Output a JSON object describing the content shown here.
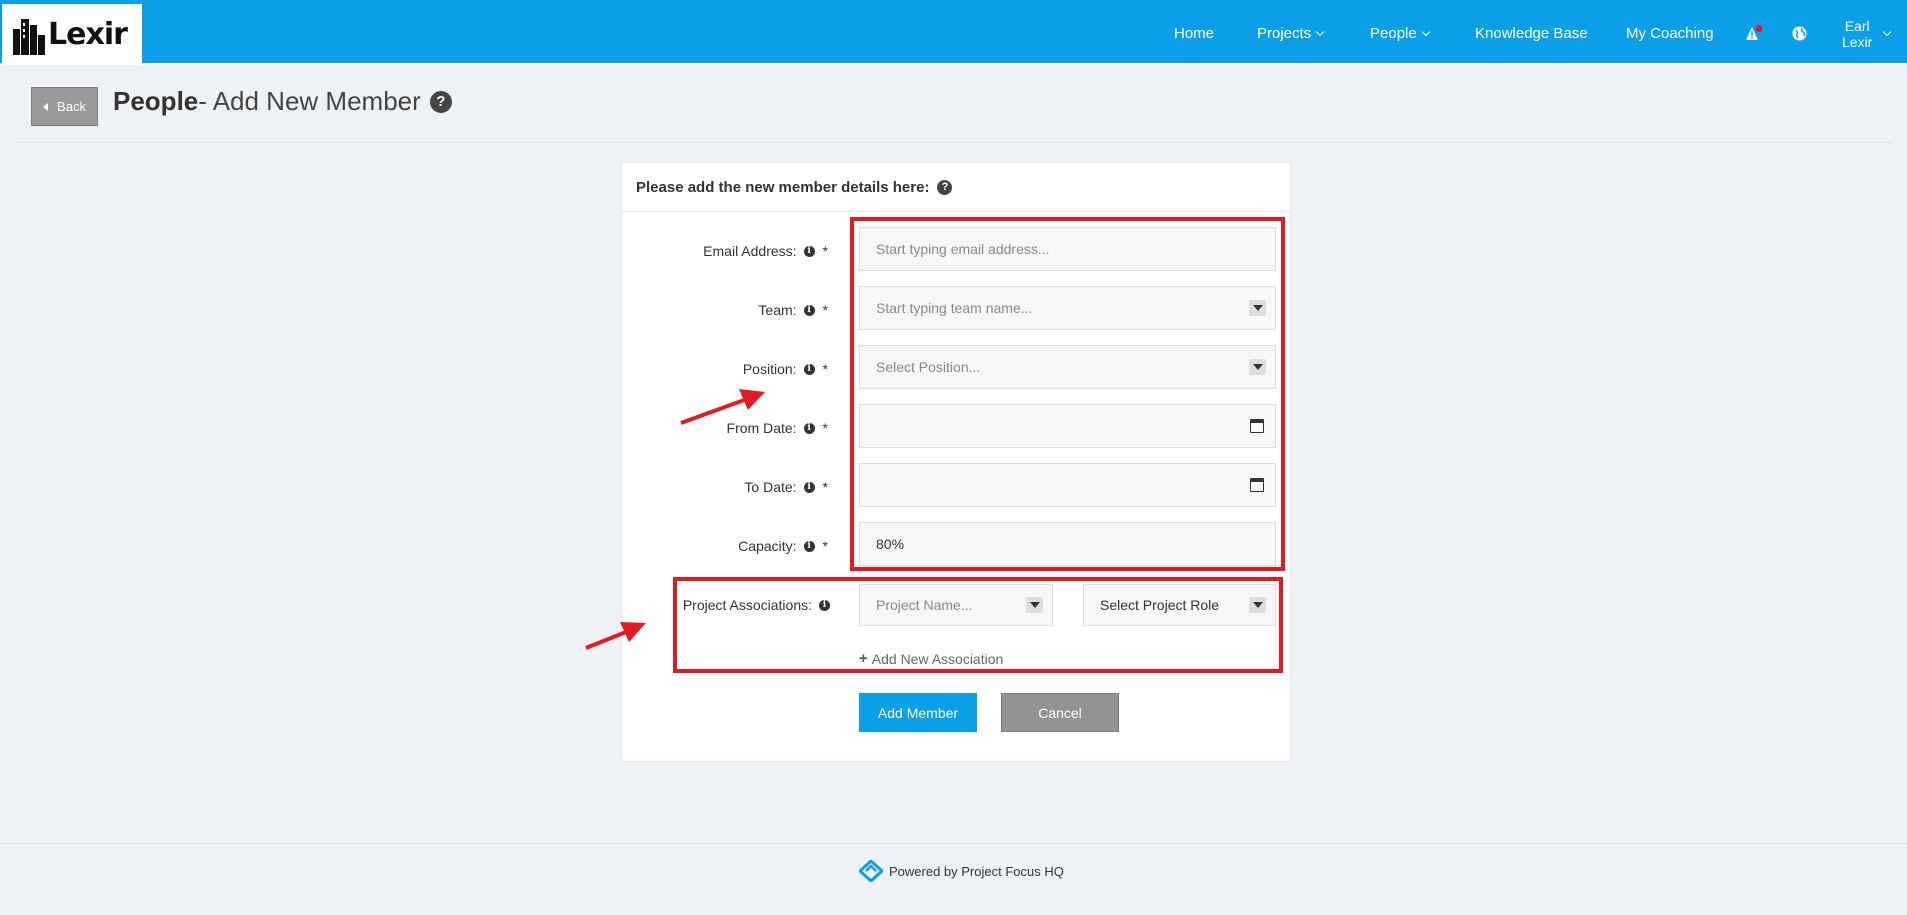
{
  "app": {
    "logo_text": "Lexir"
  },
  "nav": {
    "home": "Home",
    "projects": "Projects",
    "people": "People",
    "knowledge_base": "Knowledge Base",
    "my_coaching": "My Coaching",
    "user_first": "Earl",
    "user_last": "Lexir",
    "alert_icon": "alert-triangle-icon",
    "globe_icon": "globe-icon"
  },
  "header": {
    "back_label": "Back",
    "title_bold": "People",
    "title_rest": "- Add New Member",
    "help_glyph": "?"
  },
  "form": {
    "heading": "Please add the new member details here:",
    "email_label": "Email Address:",
    "email_placeholder": "Start typing email address...",
    "team_label": "Team:",
    "team_placeholder": "Start typing team name...",
    "position_label": "Position:",
    "position_placeholder": "Select Position...",
    "from_date_label": "From Date:",
    "from_date_value": "",
    "to_date_label": "To Date:",
    "to_date_value": "",
    "capacity_label": "Capacity:",
    "capacity_value": "80%",
    "project_assoc_label": "Project Associations:",
    "project_name_placeholder": "Project Name...",
    "project_role_placeholder": "Select Project Role",
    "add_association": "Add New Association",
    "required_mark": "*",
    "info_glyph": "i"
  },
  "actions": {
    "add_member": "Add Member",
    "cancel": "Cancel"
  },
  "footer": {
    "powered_by": "Powered by Project Focus HQ"
  },
  "colors": {
    "brand": "#0a9fe6",
    "annotation_red": "#e01b22",
    "cancel_gray": "#939393"
  }
}
